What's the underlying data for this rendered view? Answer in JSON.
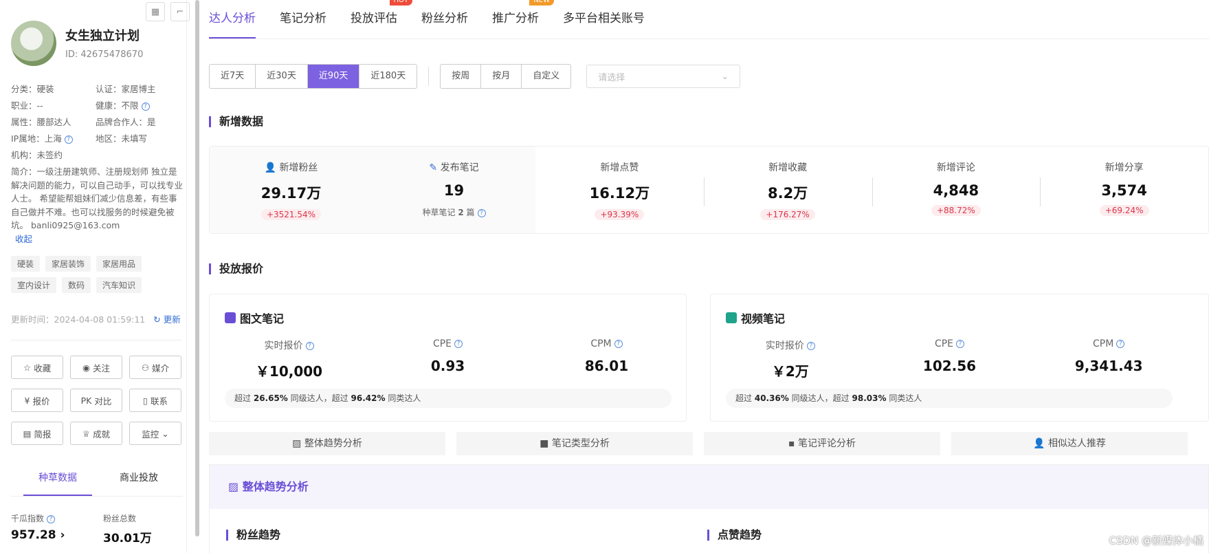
{
  "profile": {
    "name": "女生独立计划",
    "id_text": "ID: 42675478670",
    "info": [
      [
        "分类：硬装",
        "认证：家居博主"
      ],
      [
        "职业：--",
        "健康：不限"
      ],
      [
        "属性：腰部达人",
        "品牌合作人：是"
      ],
      [
        "IP属地：上海",
        "地区：未填写"
      ],
      [
        "机构：未签约",
        ""
      ]
    ],
    "intro": "简介：一级注册建筑师、注册规划师 独立是解决问题的能力，可以自己动手，可以找专业人士。 希望能帮姐妹们减少信息差，有些事自己做并不难。也可以找服务的时候避免被坑。 banli0925@163.com",
    "collapse_label": "收起",
    "tags": [
      "硬装",
      "家居装饰",
      "家居用品",
      "室内设计",
      "数码",
      "汽车知识"
    ],
    "update_time": "更新时间：2024-04-08 01:59:11",
    "update_label": "更新",
    "buttons": [
      {
        "icon": "☆",
        "label": "收藏"
      },
      {
        "icon": "◉",
        "label": "关注"
      },
      {
        "icon": "⚇",
        "label": "媒介"
      },
      {
        "icon": "¥",
        "label": "报价"
      },
      {
        "icon": "PK",
        "label": "对比"
      },
      {
        "icon": "▯",
        "label": "联系"
      },
      {
        "icon": "▤",
        "label": "简报"
      },
      {
        "icon": "♕",
        "label": "成就"
      },
      {
        "icon": "⌄",
        "label": "监控"
      }
    ],
    "tabs": [
      "种草数据",
      "商业投放"
    ],
    "metrics": [
      {
        "label": "千瓜指数",
        "value": "957.28"
      },
      {
        "label": "粉丝总数",
        "value": "30.01万"
      }
    ]
  },
  "nav": {
    "items": [
      "达人分析",
      "笔记分析",
      "投放评估",
      "粉丝分析",
      "推广分析",
      "多平台相关账号"
    ],
    "hot": "HOT",
    "new": "NEW"
  },
  "filters": {
    "range": [
      "近7天",
      "近30天",
      "近90天",
      "近180天"
    ],
    "period": [
      "按周",
      "按月",
      "自定义"
    ],
    "select_placeholder": "请选择"
  },
  "new_data": {
    "title": "新增数据",
    "items": [
      {
        "label": "新增粉丝",
        "value": "29.17万",
        "change": "+3521.54%"
      },
      {
        "label": "发布笔记",
        "value": "19",
        "sub_prefix": "种草笔记",
        "sub_value": "2",
        "sub_suffix": "篇"
      },
      {
        "label": "新增点赞",
        "value": "16.12万",
        "change": "+93.39%"
      },
      {
        "label": "新增收藏",
        "value": "8.2万",
        "change": "+176.27%"
      },
      {
        "label": "新增评论",
        "value": "4,848",
        "change": "+88.72%"
      },
      {
        "label": "新增分享",
        "value": "3,574",
        "change": "+69.24%"
      }
    ]
  },
  "pricing": {
    "title": "投放报价",
    "cards": [
      {
        "title": "图文笔记",
        "cols": [
          {
            "label": "实时报价",
            "value": "￥10,000"
          },
          {
            "label": "CPE",
            "value": "0.93"
          },
          {
            "label": "CPM",
            "value": "86.01"
          }
        ],
        "foot": {
          "a": "超过",
          "p1": "26.65%",
          "b": "同级达人，超过",
          "p2": "96.42%",
          "c": "同类达人"
        }
      },
      {
        "title": "视频笔记",
        "cols": [
          {
            "label": "实时报价",
            "value": "￥2万"
          },
          {
            "label": "CPE",
            "value": "102.56"
          },
          {
            "label": "CPM",
            "value": "9,341.43"
          }
        ],
        "foot": {
          "a": "超过",
          "p1": "40.36%",
          "b": "同级达人，超过",
          "p2": "98.03%",
          "c": "同类达人"
        }
      }
    ]
  },
  "analysis_tabs": [
    "整体趋势分析",
    "笔记类型分析",
    "笔记评论分析",
    "相似达人推荐"
  ],
  "trend": {
    "title": "整体趋势分析",
    "fans_title": "粉丝趋势",
    "likes_title": "点赞趋势"
  },
  "watermark": "CSDN @新媒体小橘",
  "colors": {
    "accent": "#6a4ed6",
    "segment_on": "#7c61e0",
    "positive": "#d9364a"
  }
}
